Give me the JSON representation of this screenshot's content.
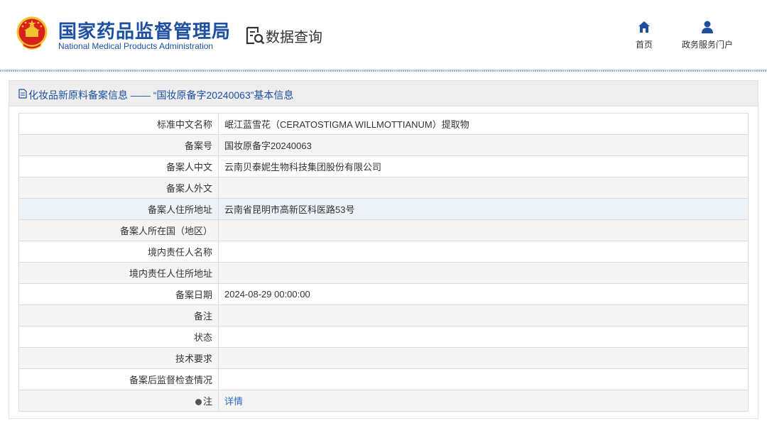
{
  "header": {
    "org_name_cn": "国家药品监督管理局",
    "org_name_en": "National Medical Products Administration",
    "section_title": "数据查询",
    "nav": [
      {
        "label": "首页",
        "icon": "home-icon"
      },
      {
        "label": "政务服务门户",
        "icon": "user-icon"
      }
    ]
  },
  "panel": {
    "title": "化妆品新原料备案信息 —— “国妆原备字20240063”基本信息",
    "rows": [
      {
        "label": "标准中文名称",
        "value": "岷江蓝雪花（CERATOSTIGMA WILLMOTTIANUM）提取物"
      },
      {
        "label": "备案号",
        "value": "国妆原备字20240063"
      },
      {
        "label": "备案人中文",
        "value": "云南贝泰妮生物科技集团股份有限公司"
      },
      {
        "label": "备案人外文",
        "value": ""
      },
      {
        "label": "备案人住所地址",
        "value": "云南省昆明市高新区科医路53号"
      },
      {
        "label": "备案人所在国（地区）",
        "value": ""
      },
      {
        "label": "境内责任人名称",
        "value": ""
      },
      {
        "label": "境内责任人住所地址",
        "value": ""
      },
      {
        "label": "备案日期",
        "value": "2024-08-29 00:00:00"
      },
      {
        "label": "备注",
        "value": ""
      },
      {
        "label": "状态",
        "value": ""
      },
      {
        "label": "技术要求",
        "value": ""
      },
      {
        "label": "备案后监督检查情况",
        "value": ""
      },
      {
        "label": "注",
        "value": "详情"
      }
    ]
  },
  "colors": {
    "brand_blue": "#1d4fa3",
    "link_blue": "#2c6cc4",
    "emblem_red": "#d8201c",
    "emblem_gold": "#f2c230"
  }
}
